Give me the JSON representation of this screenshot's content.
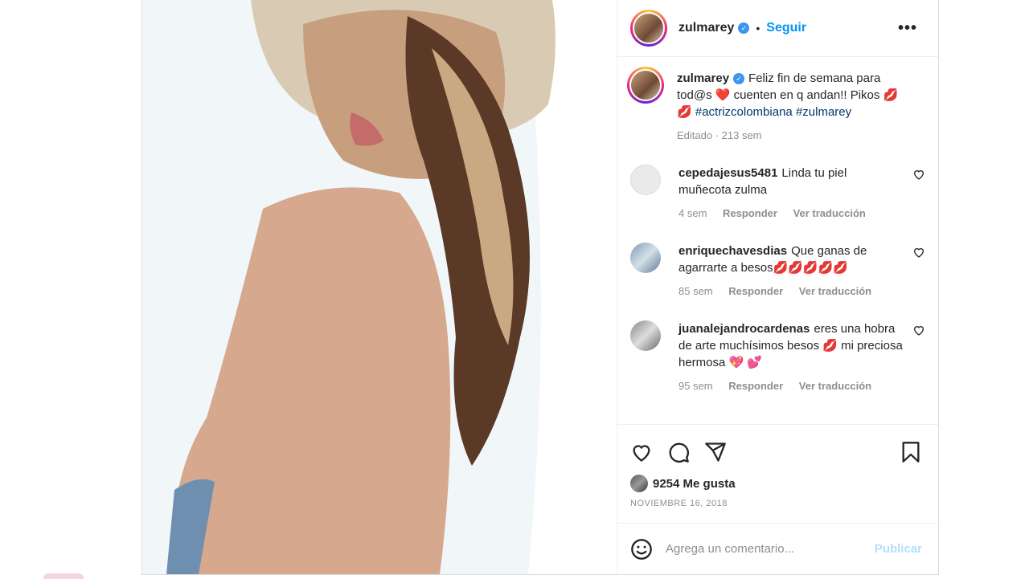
{
  "post": {
    "username": "zulmarey",
    "follow_label": "Seguir",
    "more_label": "•••",
    "separator": "•",
    "caption_text": "Feliz fin de semana para tod@s ❤️ cuenten en q andan!! Pikos 💋💋",
    "hashtags": [
      "#actrizcolombiana",
      "#zulmarey"
    ],
    "caption_meta": "Editado · 213 sem"
  },
  "comments": [
    {
      "username": "cepedajesus5481",
      "text": "Linda tu piel muñecota zulma",
      "time": "4 sem",
      "reply_label": "Responder",
      "translate_label": "Ver traducción"
    },
    {
      "username": "enriquechavesdias",
      "text": "Que ganas de agarrarte a besos💋💋💋💋💋",
      "time": "85 sem",
      "reply_label": "Responder",
      "translate_label": "Ver traducción"
    },
    {
      "username": "juanalejandrocardenas",
      "text": "eres una hobra de arte muchísimos besos 💋 mi preciosa hermosa 💖 💕",
      "time": "95 sem",
      "reply_label": "Responder",
      "translate_label": "Ver traducción"
    }
  ],
  "stats": {
    "likes": "9254 Me gusta",
    "date": "NOVIEMBRE 16, 2018"
  },
  "composer": {
    "placeholder": "Agrega un comentario...",
    "publish_label": "Publicar"
  },
  "colors": {
    "accent": "#0095f6",
    "verified": "#3897f0",
    "publish_disabled": "#b2dffc",
    "muted": "#8e8e8e"
  },
  "icons": [
    "heart-icon",
    "comment-icon",
    "share-icon",
    "bookmark-icon",
    "emoji-icon",
    "verified-icon",
    "more-icon"
  ]
}
